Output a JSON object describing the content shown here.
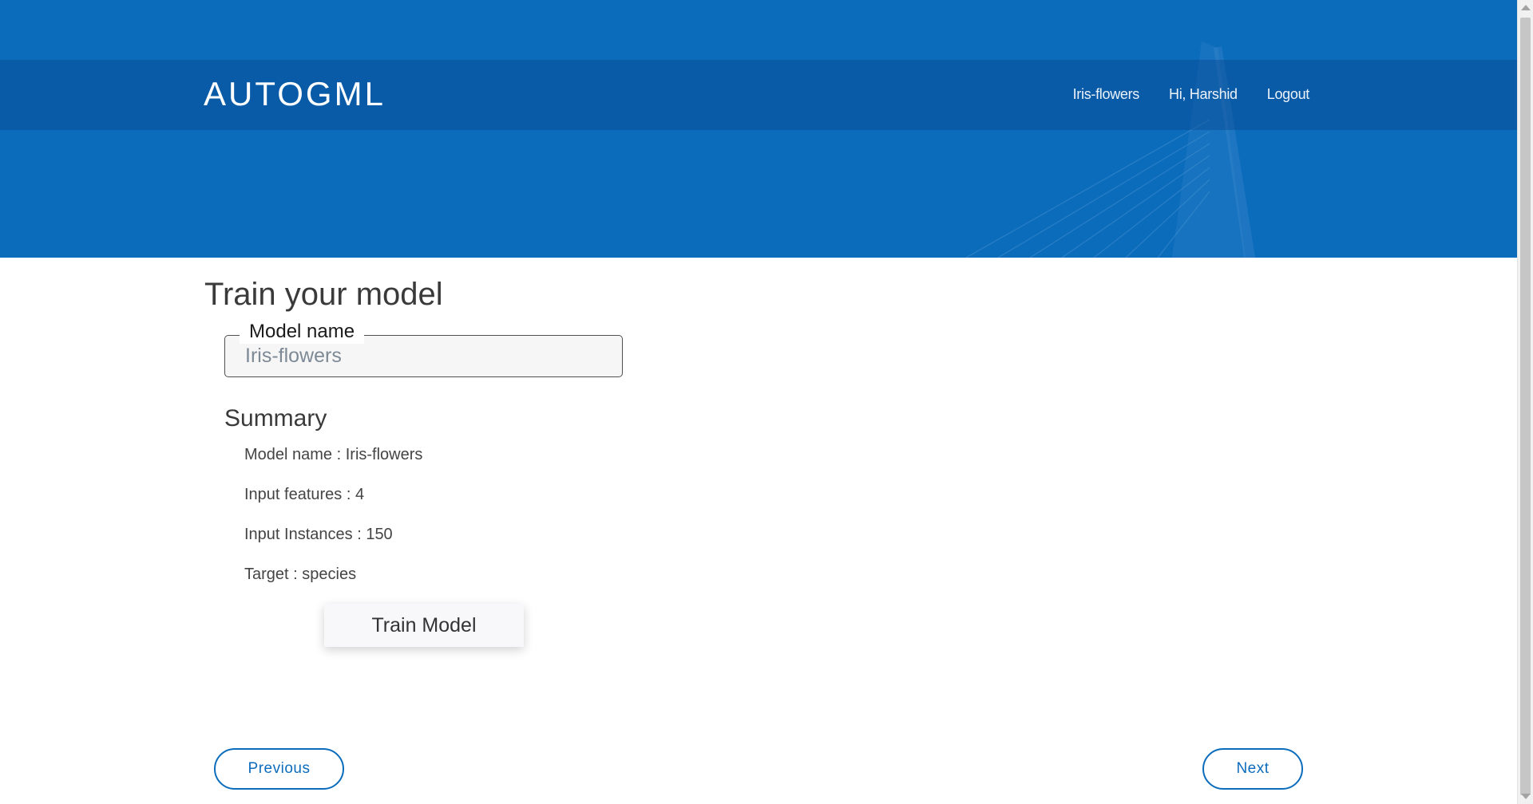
{
  "header": {
    "brand": "AUTOGML",
    "nav": [
      {
        "label": "Iris-flowers"
      },
      {
        "label": "Hi, Harshid"
      },
      {
        "label": "Logout"
      }
    ]
  },
  "main": {
    "title": "Train your model",
    "model_name_field": {
      "legend": "Model name",
      "placeholder": "Iris-flowers",
      "value": ""
    },
    "summary": {
      "title": "Summary",
      "items": [
        {
          "text": "Model name : Iris-flowers"
        },
        {
          "text": "Input features : 4"
        },
        {
          "text": "Input Instances : 150"
        },
        {
          "text": "Target : species"
        }
      ]
    },
    "train_button": "Train Model",
    "previous_button": "Previous",
    "next_button": "Next"
  },
  "colors": {
    "primary": "#0c6cbc",
    "navbar_overlay": "#0a5aa5",
    "text": "#3a3a3a"
  },
  "icons": {
    "hero_background": "bridge-skyline-image"
  }
}
